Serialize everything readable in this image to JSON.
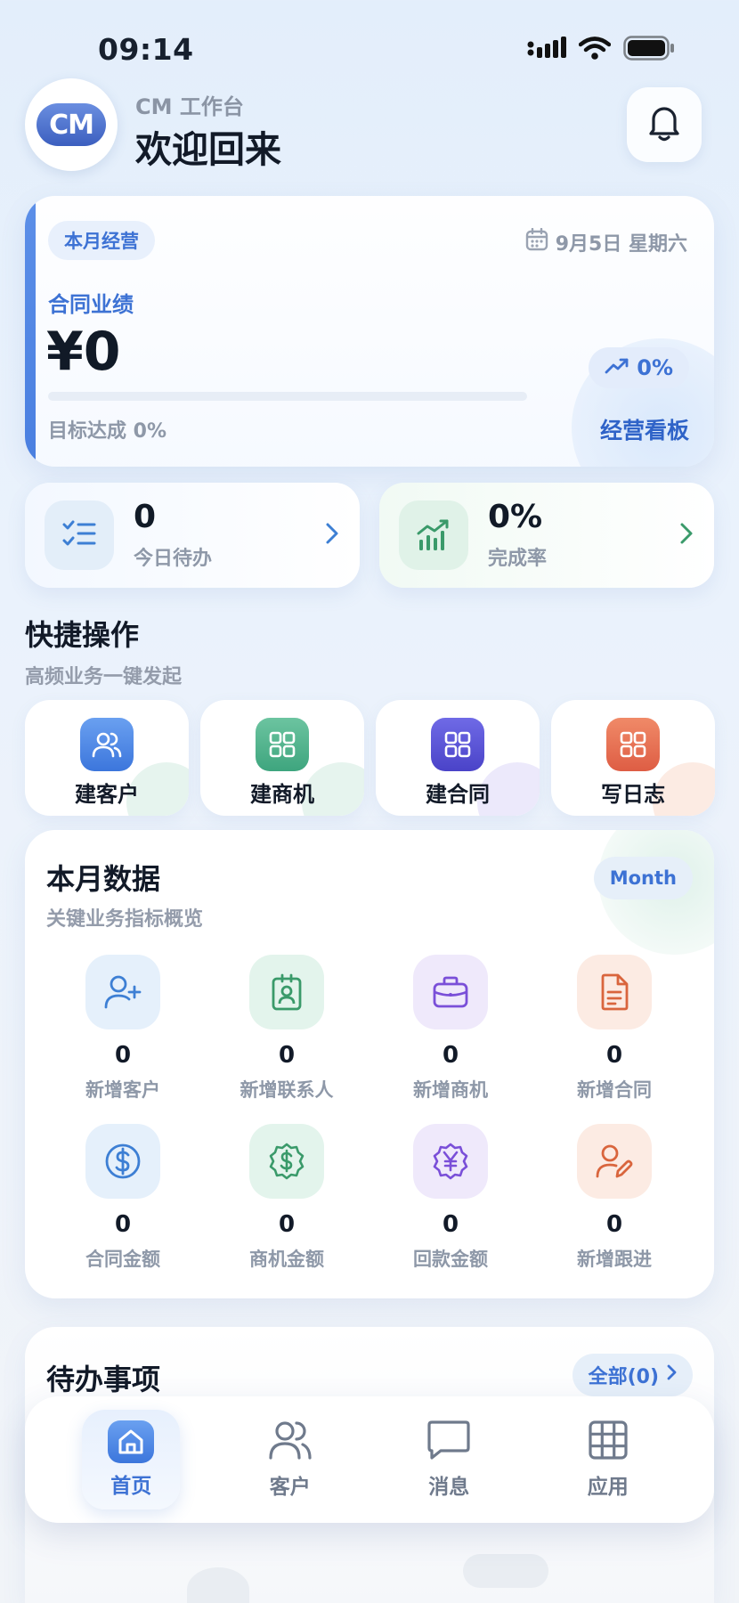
{
  "status_bar": {
    "time": "09:14"
  },
  "header": {
    "app_name": "CM 工作台",
    "greeting": "欢迎回来",
    "avatar_text": "CM"
  },
  "performance": {
    "tag": "本月经营",
    "date": "9月5日 星期六",
    "label": "合同业绩",
    "value": "¥0",
    "progress_label": "目标达成 0%",
    "progress_fraction": 0,
    "trend": "0%",
    "board_link": "经营看板",
    "accent_color": "#4a7fe0"
  },
  "summary": [
    {
      "value": "0",
      "label": "今日待办",
      "icon": "checklist-icon",
      "color": "#3d7fd4"
    },
    {
      "value": "0%",
      "label": "完成率",
      "icon": "bar-chart-icon",
      "color": "#3a9a6a"
    }
  ],
  "quick_actions": {
    "title": "快捷操作",
    "subtitle": "高频业务一键发起",
    "items": [
      {
        "label": "建客户",
        "icon": "users-icon",
        "color": "#4a86e8"
      },
      {
        "label": "建商机",
        "icon": "grid-icon",
        "color": "#4ab08a"
      },
      {
        "label": "建合同",
        "icon": "grid-icon",
        "color": "#5a55d8"
      },
      {
        "label": "写日志",
        "icon": "grid-icon",
        "color": "#e86a50"
      }
    ]
  },
  "month_data": {
    "title": "本月数据",
    "subtitle": "关键业务指标概览",
    "period": "Month",
    "stats": [
      {
        "value": "0",
        "label": "新增客户",
        "icon": "user-plus-icon"
      },
      {
        "value": "0",
        "label": "新增联系人",
        "icon": "contact-badge-icon"
      },
      {
        "value": "0",
        "label": "新增商机",
        "icon": "briefcase-icon"
      },
      {
        "value": "0",
        "label": "新增合同",
        "icon": "document-icon"
      },
      {
        "value": "0",
        "label": "合同金额",
        "icon": "dollar-circle-icon"
      },
      {
        "value": "0",
        "label": "商机金额",
        "icon": "dollar-badge-icon"
      },
      {
        "value": "0",
        "label": "回款金额",
        "icon": "yen-badge-icon"
      },
      {
        "value": "0",
        "label": "新增跟进",
        "icon": "user-edit-icon"
      }
    ]
  },
  "todo": {
    "title": "待办事项",
    "all_link": "全部(0)"
  },
  "tabbar": [
    {
      "label": "首页",
      "icon": "home-icon",
      "active": true
    },
    {
      "label": "客户",
      "icon": "users-icon",
      "active": false
    },
    {
      "label": "消息",
      "icon": "message-icon",
      "active": false
    },
    {
      "label": "应用",
      "icon": "apps-grid-icon",
      "active": false
    }
  ]
}
